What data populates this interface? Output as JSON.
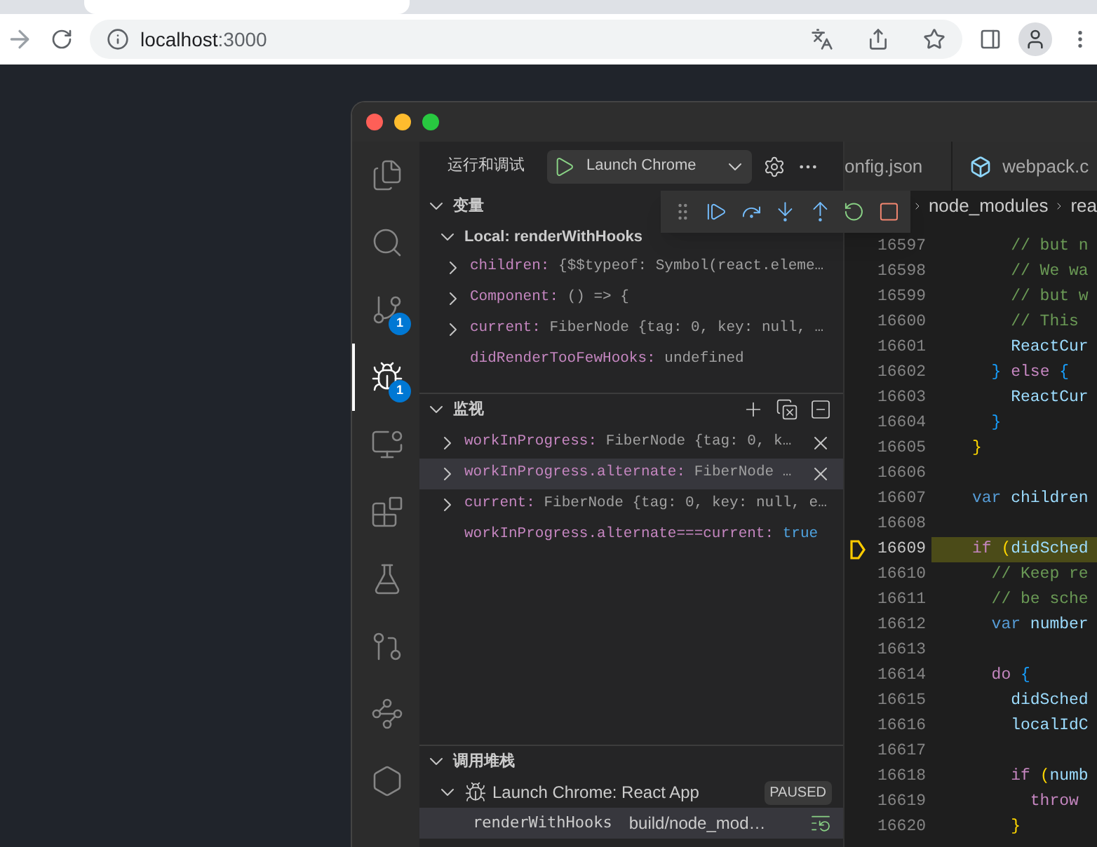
{
  "browser": {
    "address": {
      "host": "localhost",
      "port": ":3000"
    }
  },
  "activity_bar": [
    {
      "selected": false
    },
    {
      "selected": false
    },
    {
      "selected": false,
      "badge": "1"
    },
    {
      "selected": true,
      "badge": "1"
    },
    {
      "selected": false
    },
    {
      "selected": false
    },
    {
      "selected": false
    },
    {
      "selected": false
    },
    {
      "selected": false
    },
    {
      "selected": false
    }
  ],
  "sidebar": {
    "title": "运行和调试",
    "launch_config": "Launch Chrome",
    "variables": {
      "title": "变量",
      "expanded": true,
      "scope": {
        "label": "Local: renderWithHooks",
        "expanded": true,
        "items": [
          {
            "name": "children:",
            "value": "{$$typeof: Symbol(react.eleme…",
            "expanded": false
          },
          {
            "name": "Component:",
            "value": "() => {",
            "expanded": false
          },
          {
            "name": "current:",
            "value": "FiberNode {tag: 0, key: null, …",
            "expanded": false
          },
          {
            "name": "didRenderTooFewHooks:",
            "value": "undefined"
          }
        ]
      }
    },
    "watch": {
      "title": "监视",
      "expanded": true,
      "items": [
        {
          "name": "workInProgress:",
          "value": "FiberNode {tag: 0, k…",
          "kind": "object",
          "expanded": false,
          "selected": false,
          "show_remove": true
        },
        {
          "name": "workInProgress.alternate:",
          "value": "FiberNode …",
          "kind": "object",
          "expanded": false,
          "selected": true,
          "show_remove": true
        },
        {
          "name": "current:",
          "value": "FiberNode {tag: 0, key: null, e…",
          "kind": "object",
          "expanded": false,
          "selected": false,
          "show_remove": false
        },
        {
          "name": "workInProgress.alternate===current:",
          "value": "true",
          "kind": "boolean",
          "selected": false,
          "show_remove": false
        }
      ]
    },
    "call_stack": {
      "title": "调用堆栈",
      "expanded": true,
      "session": {
        "label": "Launch Chrome: React App",
        "status": "PAUSED",
        "expanded": true
      },
      "frames": [
        {
          "function": "renderWithHooks",
          "source": "build/node_mod…",
          "selected": true
        }
      ]
    }
  },
  "editor": {
    "tabs": [
      {
        "label": "onfig.json",
        "selected": false
      },
      {
        "label": "webpack.c",
        "selected": false
      }
    ],
    "breadcrumb": [
      "node_modules",
      "rea"
    ],
    "lines": [
      {
        "number": "16597",
        "current": false,
        "segments": [
          {
            "text": "    // but n",
            "kind": "comment"
          }
        ]
      },
      {
        "number": "16598",
        "current": false,
        "segments": [
          {
            "text": "    // We wa",
            "kind": "comment"
          }
        ]
      },
      {
        "number": "16599",
        "current": false,
        "segments": [
          {
            "text": "    // but w",
            "kind": "comment"
          }
        ]
      },
      {
        "number": "16600",
        "current": false,
        "segments": [
          {
            "text": "    // This",
            "kind": "comment"
          }
        ]
      },
      {
        "number": "16601",
        "current": false,
        "segments": [
          {
            "text": "    ReactCur",
            "kind": "variable"
          }
        ]
      },
      {
        "number": "16602",
        "current": false,
        "segments": [
          {
            "text": "  }",
            "kind": "brace2"
          },
          {
            "text": " else ",
            "kind": "control"
          },
          {
            "text": "{",
            "kind": "brace2"
          }
        ]
      },
      {
        "number": "16603",
        "current": false,
        "segments": [
          {
            "text": "    ReactCur",
            "kind": "variable"
          }
        ]
      },
      {
        "number": "16604",
        "current": false,
        "segments": [
          {
            "text": "  }",
            "kind": "brace2"
          }
        ]
      },
      {
        "number": "16605",
        "current": false,
        "segments": [
          {
            "text": "}",
            "kind": "brace1"
          }
        ]
      },
      {
        "number": "16606",
        "current": false
      },
      {
        "number": "16607",
        "current": false,
        "segments": [
          {
            "text": "var ",
            "kind": "keyword"
          },
          {
            "text": "children",
            "kind": "variable"
          }
        ]
      },
      {
        "number": "16608",
        "current": false
      },
      {
        "number": "16609",
        "current": true,
        "segments": [
          {
            "text": "if ",
            "kind": "control"
          },
          {
            "text": "(",
            "kind": "brace1"
          },
          {
            "text": "didSched",
            "kind": "variable"
          }
        ]
      },
      {
        "number": "16610",
        "current": false,
        "segments": [
          {
            "text": "  // Keep re",
            "kind": "comment"
          }
        ]
      },
      {
        "number": "16611",
        "current": false,
        "segments": [
          {
            "text": "  // be sche",
            "kind": "comment"
          }
        ]
      },
      {
        "number": "16612",
        "current": false,
        "segments": [
          {
            "text": "  var ",
            "kind": "keyword"
          },
          {
            "text": "number",
            "kind": "variable"
          }
        ]
      },
      {
        "number": "16613",
        "current": false
      },
      {
        "number": "16614",
        "current": false,
        "segments": [
          {
            "text": "  do ",
            "kind": "control"
          },
          {
            "text": "{",
            "kind": "brace2"
          }
        ]
      },
      {
        "number": "16615",
        "current": false,
        "segments": [
          {
            "text": "    didSched",
            "kind": "variable"
          }
        ]
      },
      {
        "number": "16616",
        "current": false,
        "segments": [
          {
            "text": "    localIdC",
            "kind": "variable"
          }
        ]
      },
      {
        "number": "16617",
        "current": false
      },
      {
        "number": "16618",
        "current": false,
        "segments": [
          {
            "text": "    if ",
            "kind": "control"
          },
          {
            "text": "(",
            "kind": "brace1"
          },
          {
            "text": "numb",
            "kind": "variable"
          }
        ]
      },
      {
        "number": "16619",
        "current": false,
        "segments": [
          {
            "text": "      throw",
            "kind": "control"
          }
        ]
      },
      {
        "number": "16620",
        "current": false,
        "segments": [
          {
            "text": "    }",
            "kind": "brace1"
          }
        ]
      }
    ]
  }
}
